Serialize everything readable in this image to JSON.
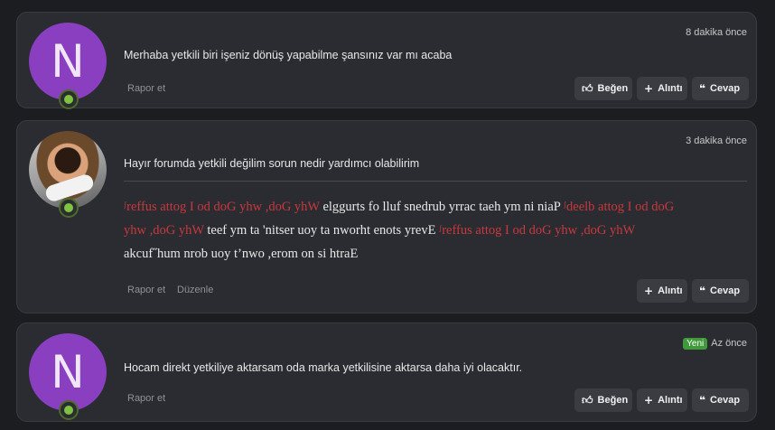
{
  "posts": [
    {
      "avatar_letter": "N",
      "time": "8 dakika önce",
      "message": "Merhaba yetkili biri işeniz dönüş yapabilme şansınız var mı acaba",
      "report": "Rapor et",
      "like": "Beğen",
      "quote": "Alıntı",
      "reply": "Cevap"
    },
    {
      "avatar_letter": "",
      "time": "3 dakika önce",
      "message": "Hayır forumda yetkili değilim sorun nedir yardımcı olabilirim",
      "signature": {
        "line1_red": "ᶴreffus attog I od doG yhw ,doG yhW",
        "line1_rest": " elggurts fo lluf snedrub yrrac taeh ym ni niaP ",
        "line1_red2": "ᶴdeelb attog I od doG",
        "line2_red": "yhw ,doG yhW",
        "line2_rest": " teef ym ta 'nitser uoy ta nworht enots yrevE ",
        "line2_red2": "ᶴreffus attog I od doG yhw ,doG yhW",
        "line3": "akcuf˝hum nrob uoy t’nwo ,erom on si htraE"
      },
      "report": "Rapor et",
      "edit": "Düzenle",
      "quote": "Alıntı",
      "reply": "Cevap"
    },
    {
      "avatar_letter": "N",
      "badge": "Yeni",
      "time": "Az önce",
      "message": "Hocam direkt yetkiliye aktarsam oda marka yetkilisine aktarsa daha iyi olacaktır.",
      "report": "Rapor et",
      "like": "Beğen",
      "quote": "Alıntı",
      "reply": "Cevap"
    }
  ],
  "icons": {
    "like": "thumbs-up-icon",
    "quote": "plus-icon",
    "reply": "quote-icon",
    "online": "online-user-icon"
  },
  "colors": {
    "avatar_purple": "#8a3fc0",
    "online_green": "#7fc241",
    "signature_red": "#c8383d",
    "new_badge": "#3f9a3a"
  }
}
